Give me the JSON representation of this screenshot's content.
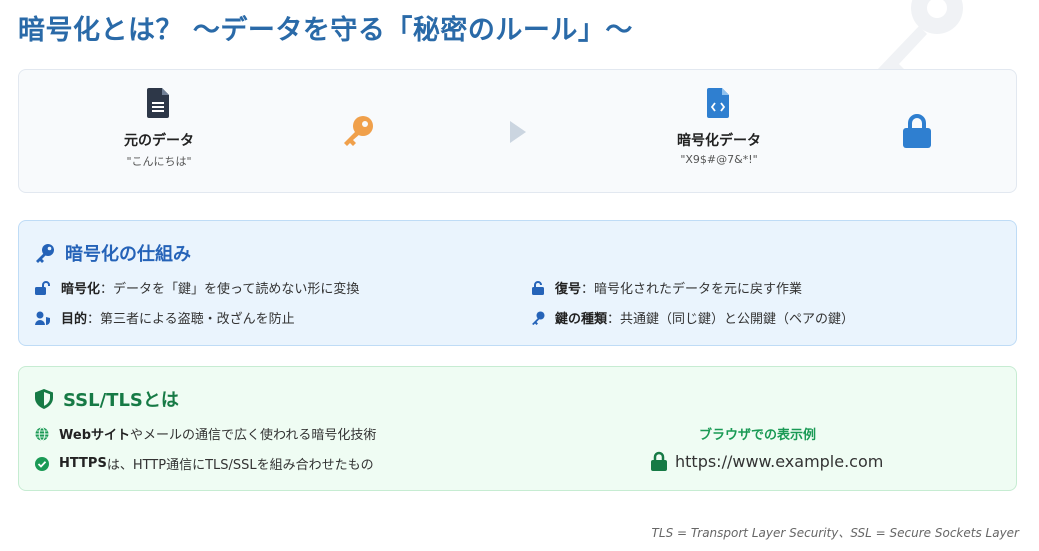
{
  "title": "暗号化とは？ 〜データを守る「秘密のルール」〜",
  "flow": {
    "original": {
      "label": "元のデータ",
      "sample": "\"こんにちは\""
    },
    "encrypted": {
      "label": "暗号化データ",
      "sample": "\"X9$#@7&*!\""
    }
  },
  "mechanism": {
    "heading": "暗号化の仕組み",
    "items": [
      {
        "term": "暗号化",
        "text": "：データを「鍵」を使って読めない形に変換",
        "icon": "lock-open-icon"
      },
      {
        "term": "復号",
        "text": "：暗号化されたデータを元に戻す作業",
        "icon": "unlock-icon"
      },
      {
        "term": "目的",
        "text": "：第三者による盗聴・改ざんを防止",
        "icon": "user-shield-icon"
      },
      {
        "term": "鍵の種類",
        "text": "：共通鍵（同じ鍵）と公開鍵（ペアの鍵）",
        "icon": "key-icon"
      }
    ]
  },
  "ssl": {
    "heading": "SSL/TLSとは",
    "items": [
      {
        "term": "Webサイト",
        "text": "やメールの通信で広く使われる暗号化技術",
        "icon": "globe-icon"
      },
      {
        "term": "HTTPS",
        "text": "は、HTTP通信にTLS/SSLを組み合わせたもの",
        "icon": "check-circle-icon"
      }
    ],
    "browser_example_title": "ブラウザでの表示例",
    "url": "https://www.example.com"
  },
  "footnote": "TLS = Transport Layer Security、SSL = Secure Sockets Layer",
  "colors": {
    "title": "#2a6aa8",
    "mechanism_accent": "#2563b8",
    "ssl_accent": "#167a45",
    "key_orange": "#f0a04b",
    "lock_blue": "#2f7fd0"
  }
}
